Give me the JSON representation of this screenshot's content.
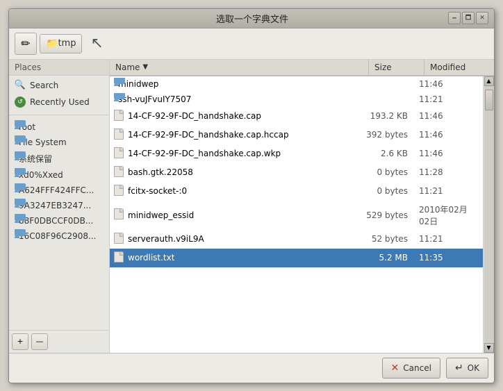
{
  "title": "选取一个字典文件",
  "titlebar": {
    "title": "选取一个字典文件",
    "btn1_label": "🗕",
    "btn2_label": "🗖",
    "btn3_label": "✕"
  },
  "toolbar": {
    "edit_icon": "✏",
    "folder_label": "tmp",
    "cursor_unicode": "↖"
  },
  "sidebar": {
    "header": "Places",
    "items": [
      {
        "label": "Search",
        "icon": "search"
      },
      {
        "label": "Recently Used",
        "icon": "recently"
      }
    ],
    "folders": [
      {
        "label": "root"
      },
      {
        "label": "File System"
      },
      {
        "label": "系统保留"
      },
      {
        "label": "xd0%Xxed"
      },
      {
        "label": "A624FFF424FFC..."
      },
      {
        "label": "9A3247EB3247..."
      },
      {
        "label": "88F0DBCCF0DB..."
      },
      {
        "label": "16C08F96C2908..."
      }
    ],
    "add_btn": "+",
    "remove_btn": "—"
  },
  "filelist": {
    "columns": {
      "name": "Name",
      "size": "Size",
      "modified": "Modified"
    },
    "rows": [
      {
        "name": "minidwep",
        "size": "",
        "modified": "11:46",
        "type": "folder"
      },
      {
        "name": "ssh-vuJFvuIY7507",
        "size": "",
        "modified": "11:21",
        "type": "folder"
      },
      {
        "name": "14-CF-92-9F-DC_handshake.cap",
        "size": "193.2 KB",
        "modified": "11:46",
        "type": "file"
      },
      {
        "name": "14-CF-92-9F-DC_handshake.cap.hccap",
        "size": "392 bytes",
        "modified": "11:46",
        "type": "file"
      },
      {
        "name": "14-CF-92-9F-DC_handshake.cap.wkp",
        "size": "2.6 KB",
        "modified": "11:46",
        "type": "file"
      },
      {
        "name": "bash.gtk.22058",
        "size": "0 bytes",
        "modified": "11:28",
        "type": "file"
      },
      {
        "name": "fcitx-socket-:0",
        "size": "0 bytes",
        "modified": "11:21",
        "type": "file"
      },
      {
        "name": "minidwep_essid",
        "size": "529 bytes",
        "modified": "2010年02月02日",
        "type": "file"
      },
      {
        "name": "serverauth.v9iL9A",
        "size": "52 bytes",
        "modified": "11:21",
        "type": "file"
      },
      {
        "name": "wordlist.txt",
        "size": "5.2 MB",
        "modified": "11:35",
        "type": "file",
        "selected": true
      }
    ]
  },
  "footer": {
    "cancel_label": "Cancel",
    "ok_label": "OK",
    "cancel_icon": "✕",
    "ok_icon": "↵"
  }
}
